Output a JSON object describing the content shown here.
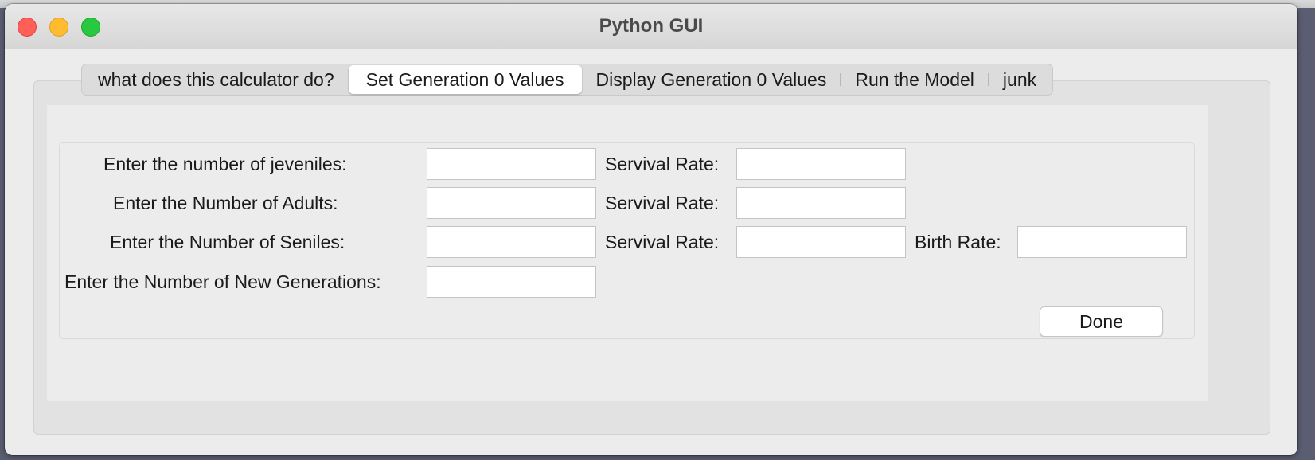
{
  "window": {
    "title": "Python GUI"
  },
  "tabs": [
    {
      "label": "what does this calculator do?",
      "active": false
    },
    {
      "label": "Set Generation 0 Values",
      "active": true
    },
    {
      "label": "Display Generation 0 Values",
      "active": false
    },
    {
      "label": "Run the Model",
      "active": false
    },
    {
      "label": "junk",
      "active": false
    }
  ],
  "form": {
    "juveniles_label": "Enter the number of jeveniles:",
    "adults_label": "Enter the Number of Adults:",
    "seniles_label": "Enter the Number of Seniles:",
    "generations_label": "Enter the Number of New Generations:",
    "survival_label": "Servival Rate:",
    "birth_label": "Birth Rate:",
    "juveniles_value": "",
    "juveniles_survival_value": "",
    "adults_value": "",
    "adults_survival_value": "",
    "seniles_value": "",
    "seniles_survival_value": "",
    "birth_rate_value": "",
    "generations_value": "",
    "done_label": "Done"
  },
  "colors": {
    "close": "#fe5f57",
    "minimize": "#febc2e",
    "zoom": "#28c840",
    "window_bg": "#ececec"
  }
}
